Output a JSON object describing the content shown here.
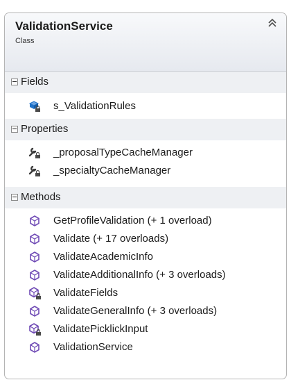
{
  "class": {
    "name": "ValidationService",
    "kind": "Class"
  },
  "sections": {
    "fields": {
      "label": "Fields",
      "items": [
        {
          "text": "s_ValidationRules",
          "icon": "field-private-icon"
        }
      ]
    },
    "properties": {
      "label": "Properties",
      "items": [
        {
          "text": "_proposalTypeCacheManager",
          "icon": "property-private-icon"
        },
        {
          "text": "_specialtyCacheManager",
          "icon": "property-private-icon"
        }
      ]
    },
    "methods": {
      "label": "Methods",
      "items": [
        {
          "text": "GetProfileValidation (+ 1 overload)",
          "icon": "method-icon"
        },
        {
          "text": "Validate (+ 17 overloads)",
          "icon": "method-icon"
        },
        {
          "text": "ValidateAcademicInfo",
          "icon": "method-icon"
        },
        {
          "text": "ValidateAdditionalInfo (+ 3 overloads)",
          "icon": "method-icon"
        },
        {
          "text": "ValidateFields",
          "icon": "method-private-icon"
        },
        {
          "text": "ValidateGeneralInfo (+ 3 overloads)",
          "icon": "method-icon"
        },
        {
          "text": "ValidatePicklickInput",
          "icon": "method-private-icon"
        },
        {
          "text": "ValidationService",
          "icon": "method-icon"
        }
      ]
    }
  },
  "colors": {
    "method": "#6f4ab5",
    "field": "#1f72c8",
    "wrench": "#3a3a3a",
    "lock": "#4a4a4a"
  }
}
